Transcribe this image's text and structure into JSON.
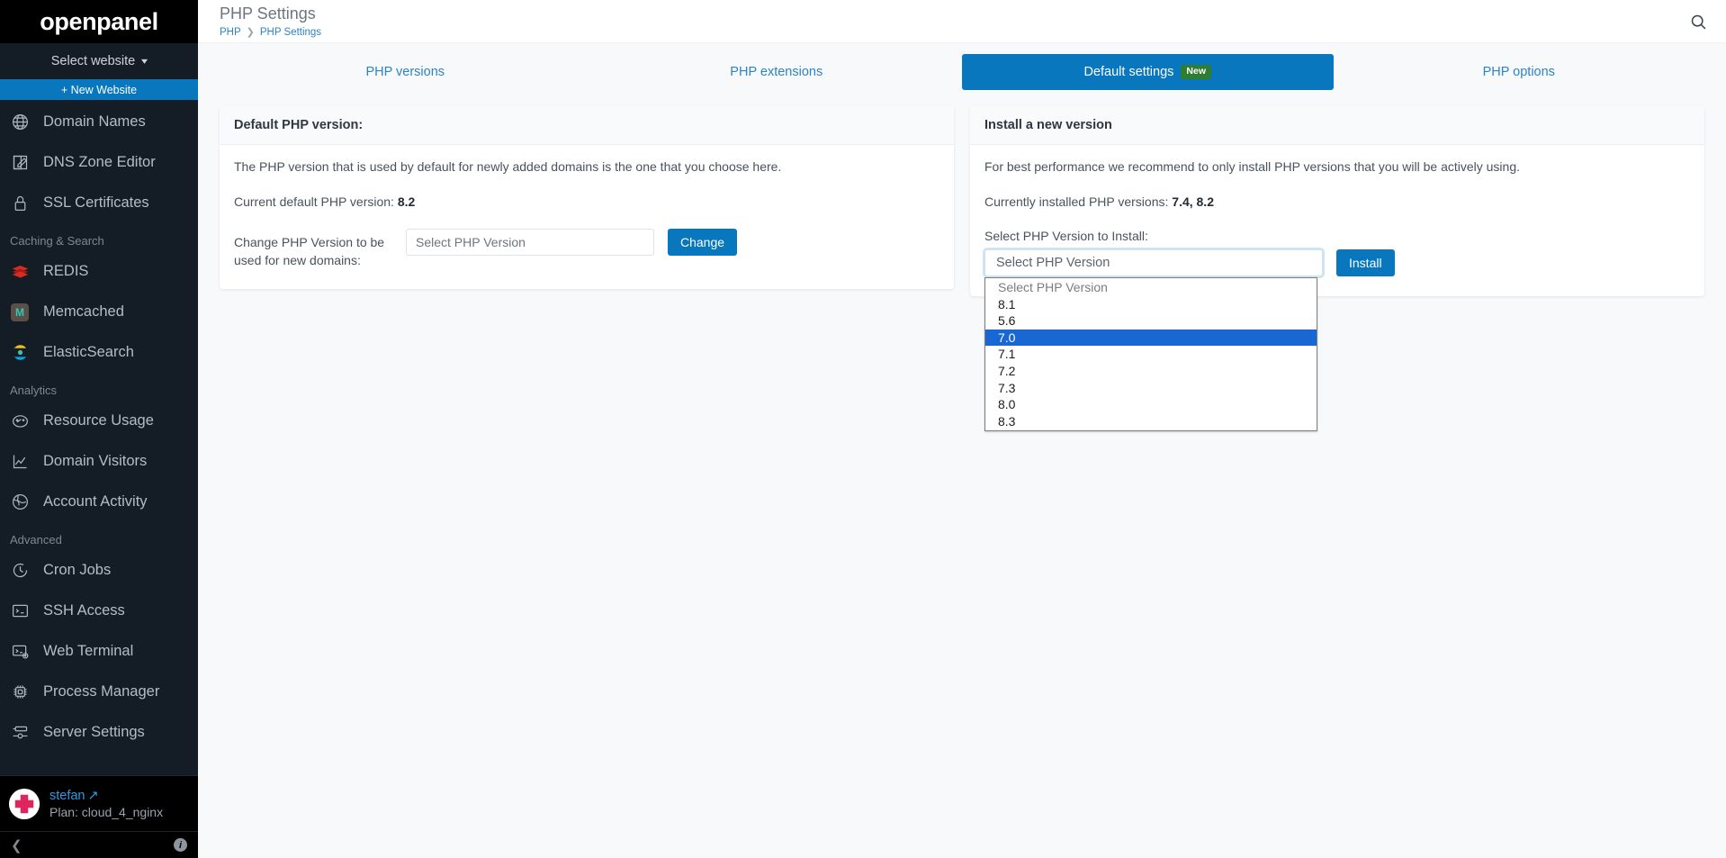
{
  "sidebar": {
    "brand": "openpanel",
    "website_selector": "Select website",
    "new_website": "+ New Website",
    "items": [
      {
        "label": "Domain Names",
        "icon": "globe-icon"
      },
      {
        "label": "DNS Zone Editor",
        "icon": "edit-square-icon"
      },
      {
        "label": "SSL Certificates",
        "icon": "lock-icon"
      }
    ],
    "groups": [
      {
        "title": "Caching & Search",
        "items": [
          {
            "label": "REDIS",
            "icon": "redis-icon"
          },
          {
            "label": "Memcached",
            "icon": "memcached-icon"
          },
          {
            "label": "ElasticSearch",
            "icon": "elasticsearch-icon"
          }
        ]
      },
      {
        "title": "Analytics",
        "items": [
          {
            "label": "Resource Usage",
            "icon": "gauge-icon"
          },
          {
            "label": "Domain Visitors",
            "icon": "line-chart-icon"
          },
          {
            "label": "Account Activity",
            "icon": "globe-activity-icon"
          }
        ]
      },
      {
        "title": "Advanced",
        "items": [
          {
            "label": "Cron Jobs",
            "icon": "clock-icon"
          },
          {
            "label": "SSH Access",
            "icon": "terminal-icon"
          },
          {
            "label": "Web Terminal",
            "icon": "web-terminal-icon"
          },
          {
            "label": "Process Manager",
            "icon": "cpu-icon"
          },
          {
            "label": "Server Settings",
            "icon": "server-settings-icon"
          }
        ]
      }
    ],
    "user": {
      "name": "stefan",
      "plan": "Plan: cloud_4_nginx"
    }
  },
  "header": {
    "title": "PHP Settings",
    "breadcrumb": [
      "PHP",
      "PHP Settings"
    ],
    "breadcrumb_separator": "❯",
    "search_icon": "search-icon"
  },
  "tabs": [
    {
      "label": "PHP versions",
      "active": false,
      "badge": ""
    },
    {
      "label": "PHP extensions",
      "active": false,
      "badge": ""
    },
    {
      "label": "Default settings",
      "active": true,
      "badge": "New"
    },
    {
      "label": "PHP options",
      "active": false,
      "badge": ""
    }
  ],
  "left_card": {
    "title": "Default PHP version:",
    "description": "The PHP version that is used by default for newly added domains is the one that you choose here.",
    "current_label": "Current default PHP version:",
    "current_value": "8.2",
    "change_label": "Change PHP Version to be used for new domains:",
    "select_value": "Select PHP Version",
    "change_button": "Change"
  },
  "right_card": {
    "title": "Install a new version",
    "description": "For best performance we recommend to only install PHP versions that you will be actively using.",
    "installed_label": "Currently installed PHP versions:",
    "installed_value": "7.4, 8.2",
    "select_label": "Select PHP Version to Install:",
    "select_value": "Select PHP Version",
    "install_button": "Install",
    "options": [
      {
        "label": "Select PHP Version",
        "placeholder": true,
        "selected": false
      },
      {
        "label": "8.1",
        "placeholder": false,
        "selected": false
      },
      {
        "label": "5.6",
        "placeholder": false,
        "selected": false
      },
      {
        "label": "7.0",
        "placeholder": false,
        "selected": true
      },
      {
        "label": "7.1",
        "placeholder": false,
        "selected": false
      },
      {
        "label": "7.2",
        "placeholder": false,
        "selected": false
      },
      {
        "label": "7.3",
        "placeholder": false,
        "selected": false
      },
      {
        "label": "8.0",
        "placeholder": false,
        "selected": false
      },
      {
        "label": "8.3",
        "placeholder": false,
        "selected": false
      }
    ]
  },
  "colors": {
    "accent": "#0877bd",
    "sidebar_bg": "#141c26",
    "badge_green": "#2e7d32",
    "option_selected": "#1867d2",
    "link": "#2d83c7"
  }
}
